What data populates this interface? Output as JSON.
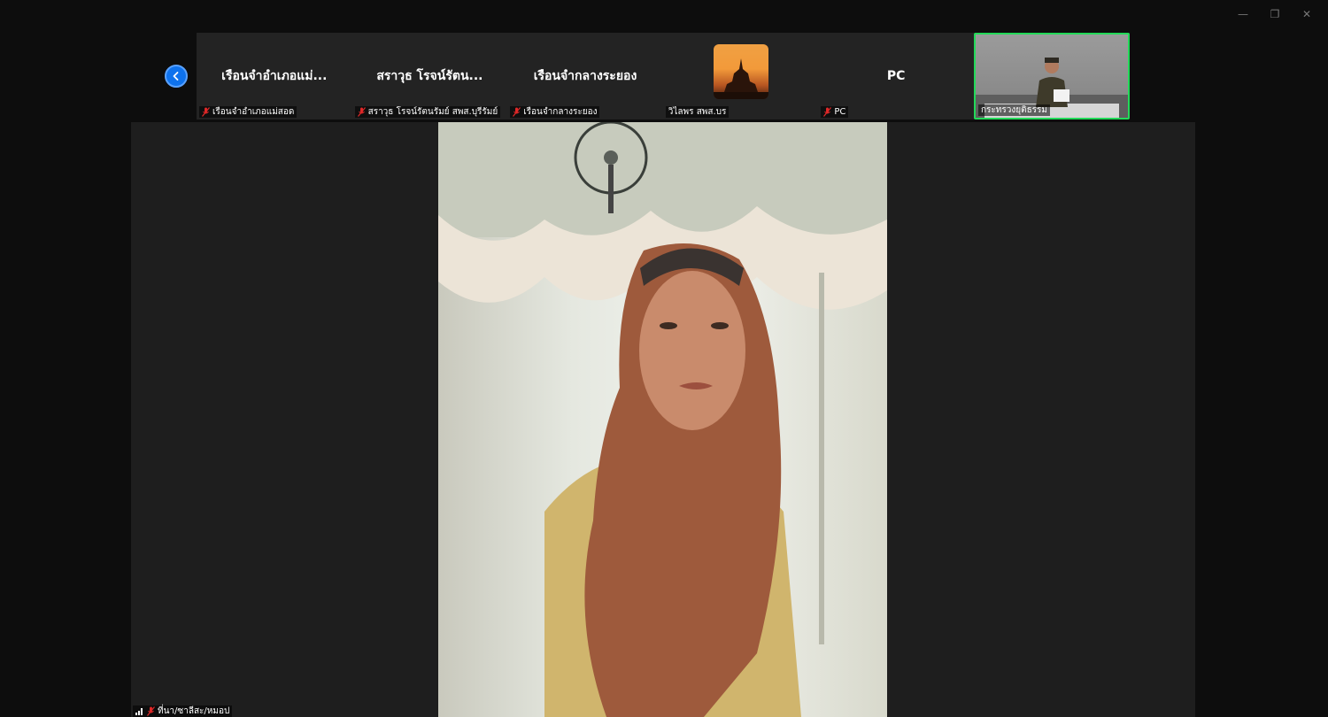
{
  "window_controls": [
    {
      "name": "minimize",
      "glyph": "—"
    },
    {
      "name": "restore",
      "glyph": "❐"
    },
    {
      "name": "close",
      "glyph": "✕"
    }
  ],
  "participants": [
    {
      "display_name": "เรือนจำอำเภอแม่...",
      "label": "เรือนจำอำเภอแม่สอด",
      "muted": true
    },
    {
      "display_name": "สราวุธ โรจน์รัตน...",
      "label": "สราวุธ โรจน์รัตนรัมย์ สพส.บุรีรัมย์",
      "muted": true
    },
    {
      "display_name": "เรือนจำกลางระยอง",
      "label": "เรือนจำกลางระยอง",
      "muted": true
    },
    {
      "display_name": "",
      "label": "วิไลพร สพส.บร",
      "muted": false
    },
    {
      "display_name": "PC",
      "label": "PC",
      "muted": true
    },
    {
      "display_name": "",
      "label": "กระทรวงยุติธรรม",
      "muted": false
    }
  ],
  "main_speaker": {
    "label": "ที่นา/ซาลีสะ/หมอป"
  },
  "colors": {
    "active_speaker": "#23d959",
    "accent": "#0e72ed",
    "muted_mic": "#e02828"
  }
}
